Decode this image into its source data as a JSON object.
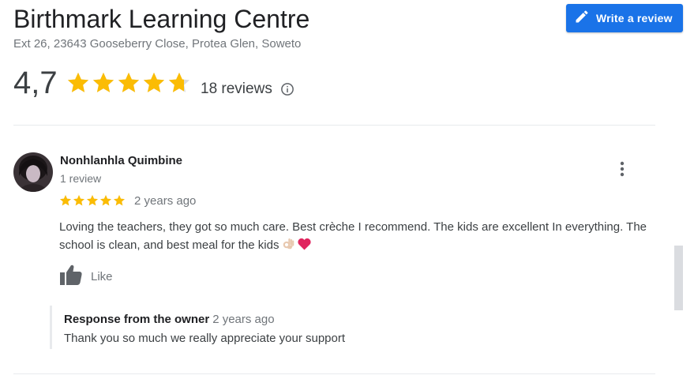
{
  "place": {
    "name": "Birthmark Learning Centre",
    "address": "Ext 26, 23643 Gooseberry Close, Protea Glen, Soweto"
  },
  "write_review": {
    "label": "Write a review",
    "icon": "pencil-icon",
    "color": "#1a73e8"
  },
  "rating": {
    "value": "4,7",
    "stars_filled_fraction": 0.94,
    "reviews_label": "18 reviews",
    "info_icon": "info-icon",
    "star_color": "#fbbc04"
  },
  "review": {
    "author": "Nonhlanhla Quimbine",
    "author_reviews": "1 review",
    "stars": 5,
    "time": "2 years ago",
    "text": "Loving  the teachers, they got so much care. Best crèche I recommend. The kids are excellent In everything. The school is clean, and best meal for the kids",
    "emojis": [
      "ok-hand-emoji",
      "heart-emoji"
    ],
    "like_label": "Like",
    "more_icon": "more-vert-icon"
  },
  "owner_response": {
    "title": "Response from the owner",
    "time": "2 years ago",
    "text": "Thank you so much we really appreciate your support"
  }
}
